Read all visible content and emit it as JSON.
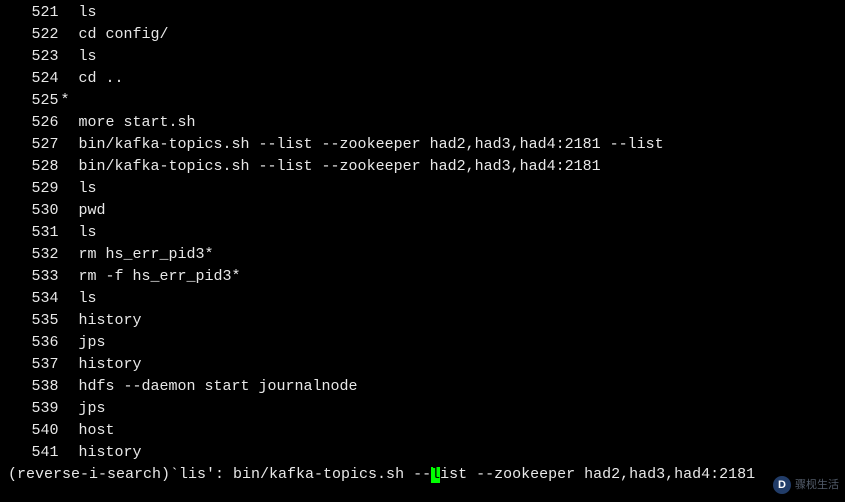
{
  "history": [
    {
      "num": "521",
      "cmd": "ls",
      "star": false
    },
    {
      "num": "522",
      "cmd": "cd config/",
      "star": false
    },
    {
      "num": "523",
      "cmd": "ls",
      "star": false
    },
    {
      "num": "524",
      "cmd": "cd ..",
      "star": false
    },
    {
      "num": "525",
      "cmd": "",
      "star": true
    },
    {
      "num": "526",
      "cmd": "more start.sh",
      "star": false
    },
    {
      "num": "527",
      "cmd": "bin/kafka-topics.sh --list --zookeeper had2,had3,had4:2181 --list",
      "star": false
    },
    {
      "num": "528",
      "cmd": "bin/kafka-topics.sh --list --zookeeper had2,had3,had4:2181",
      "star": false
    },
    {
      "num": "529",
      "cmd": "ls",
      "star": false
    },
    {
      "num": "530",
      "cmd": "pwd",
      "star": false
    },
    {
      "num": "531",
      "cmd": "ls",
      "star": false
    },
    {
      "num": "532",
      "cmd": "rm hs_err_pid3*",
      "star": false
    },
    {
      "num": "533",
      "cmd": "rm -f hs_err_pid3*",
      "star": false
    },
    {
      "num": "534",
      "cmd": "ls",
      "star": false
    },
    {
      "num": "535",
      "cmd": "history",
      "star": false
    },
    {
      "num": "536",
      "cmd": "jps",
      "star": false
    },
    {
      "num": "537",
      "cmd": "history",
      "star": false
    },
    {
      "num": "538",
      "cmd": "hdfs --daemon start journalnode",
      "star": false
    },
    {
      "num": "539",
      "cmd": "jps",
      "star": false
    },
    {
      "num": "540",
      "cmd": "host",
      "star": false
    },
    {
      "num": "541",
      "cmd": "history",
      "star": false
    }
  ],
  "prompt": {
    "prefix": "(reverse-i-search)`lis': bin/kafka-topics.sh --",
    "cursor_char": "l",
    "suffix": "ist --zookeeper had2,had3,had4:2181"
  },
  "watermark": {
    "logo": "D",
    "text": "骤枧生活"
  }
}
